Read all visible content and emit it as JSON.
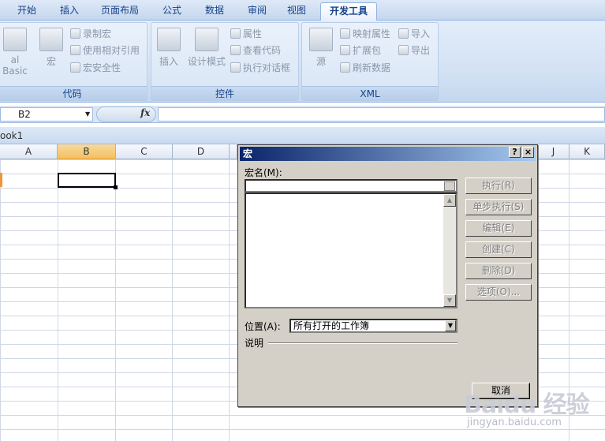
{
  "ribbon_tabs": [
    "开始",
    "插入",
    "页面布局",
    "公式",
    "数据",
    "审阅",
    "视图",
    "开发工具"
  ],
  "ribbon_groups": {
    "code": {
      "label": "代码",
      "visual_basic": "al Basic",
      "macros": "宏",
      "record_macro": "录制宏",
      "relative_refs": "使用相对引用",
      "macro_security": "宏安全性"
    },
    "controls": {
      "label": "控件",
      "insert": "插入",
      "design_mode": "设计模式",
      "properties": "属性",
      "view_code": "查看代码",
      "run_dialog": "执行对话框"
    },
    "xml": {
      "label": "XML",
      "source": "源",
      "map_properties": "映射属性",
      "expansion_packs": "扩展包",
      "refresh_data": "刷新数据",
      "import": "导入",
      "export": "导出"
    }
  },
  "formula_bar": {
    "name_box": "B2",
    "fx": "fx"
  },
  "workbook_title": "ook1",
  "columns": [
    "A",
    "B",
    "C",
    "D",
    "J",
    "K"
  ],
  "dialog": {
    "title": "宏",
    "help": "?",
    "close": "×",
    "macro_name_label": "宏名(M):",
    "buttons": [
      "执行(R)",
      "单步执行(S)",
      "编辑(E)",
      "创建(C)",
      "删除(D)",
      "选项(O)..."
    ],
    "location_label": "位置(A):",
    "location_value": "所有打开的工作簿",
    "description_label": "说明",
    "cancel": "取消"
  },
  "watermark": {
    "brand": "Baidu 经验",
    "url": "jingyan.baidu.com"
  }
}
